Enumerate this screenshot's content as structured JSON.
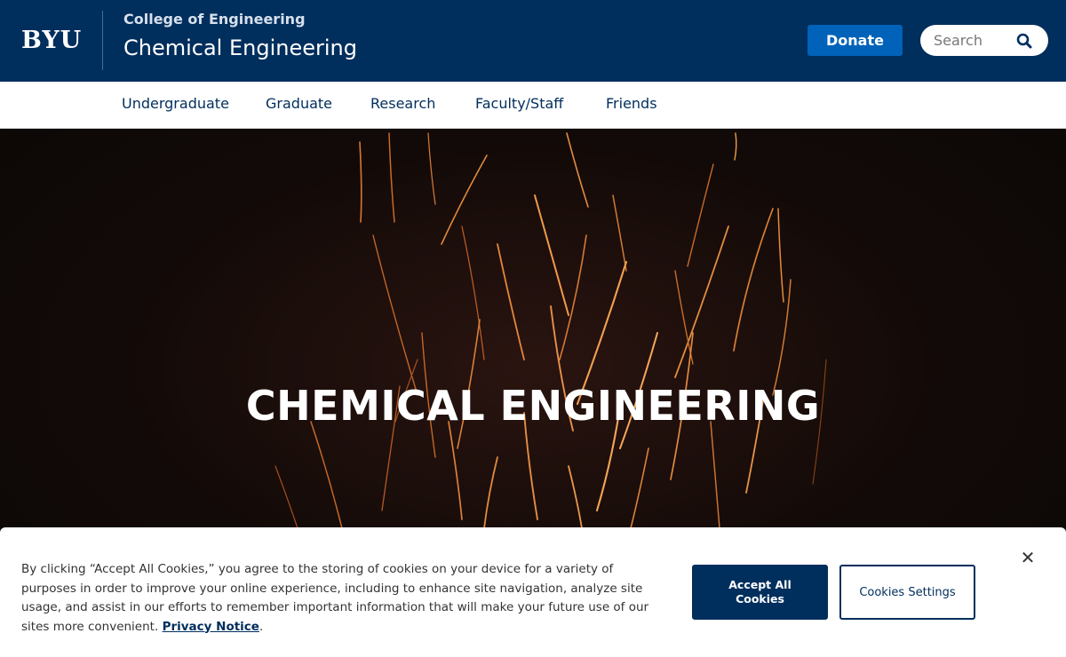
{
  "header": {
    "logo": "BYU",
    "college": "College of Engineering",
    "department": "Chemical Engineering",
    "donate_label": "Donate",
    "search_placeholder": "Search"
  },
  "nav": {
    "items": [
      {
        "label": "Undergraduate"
      },
      {
        "label": "Graduate"
      },
      {
        "label": "Research"
      },
      {
        "label": "Faculty/Staff"
      },
      {
        "label": "Friends"
      }
    ]
  },
  "hero": {
    "title": "CHEMICAL ENGINEERING"
  },
  "cookie_banner": {
    "text": "By clicking “Accept All Cookies,” you agree to the storing of cookies on your device for a variety of purposes in order to improve your online experience, including to enhance site navigation, analyze site usage, and assist in our efforts to remember important information that will make your future use of our sites more convenient.",
    "privacy_link": "Privacy Notice",
    "accept_label": "Accept All Cookies",
    "settings_label": "Cookies Settings",
    "close_glyph": "✕"
  },
  "colors": {
    "brand_navy": "#002e5d",
    "donate_blue": "#0062b8",
    "spark_orange": "#e8833a"
  }
}
